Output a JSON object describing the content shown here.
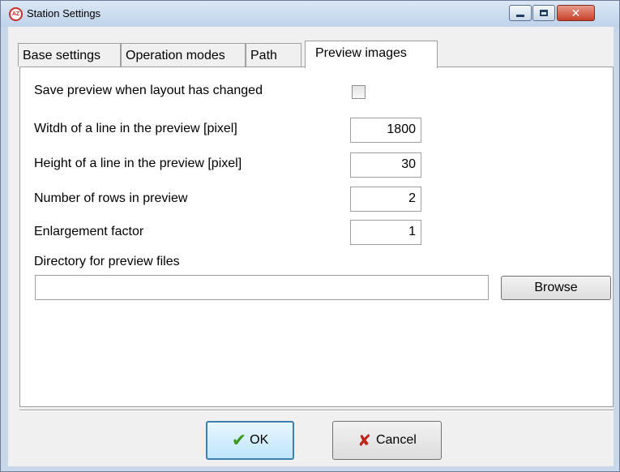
{
  "window": {
    "title": "Station Settings",
    "app_icon_text": "AZ",
    "controls": {
      "minimize": "minimize-icon",
      "maximize": "maximize-icon",
      "close": "close-icon",
      "close_glyph": "✕"
    }
  },
  "tabs": [
    {
      "label": "Base settings",
      "active": false
    },
    {
      "label": "Operation modes",
      "active": false
    },
    {
      "label": "Path",
      "active": false
    },
    {
      "label": "Preview images",
      "active": true
    }
  ],
  "form": {
    "save_preview_label": "Save preview when layout has changed",
    "save_preview_checked": false,
    "width_label": "Witdh of a line in the preview  [pixel]",
    "width_value": "1800",
    "height_label": "Height of a line in the preview [pixel]",
    "height_value": "30",
    "rows_label": "Number of rows in preview",
    "rows_value": "2",
    "enlargement_label": "Enlargement factor",
    "enlargement_value": "1",
    "directory_label": "Directory for preview files",
    "directory_value": "",
    "browse_label": "Browse"
  },
  "buttons": {
    "ok_label": "OK",
    "ok_glyph": "✔",
    "cancel_label": "Cancel",
    "cancel_glyph": "✘"
  },
  "colors": {
    "ok_check": "#3c9a1f",
    "cancel_x": "#c0241a",
    "title_gradient_top": "#dbe7f5"
  }
}
